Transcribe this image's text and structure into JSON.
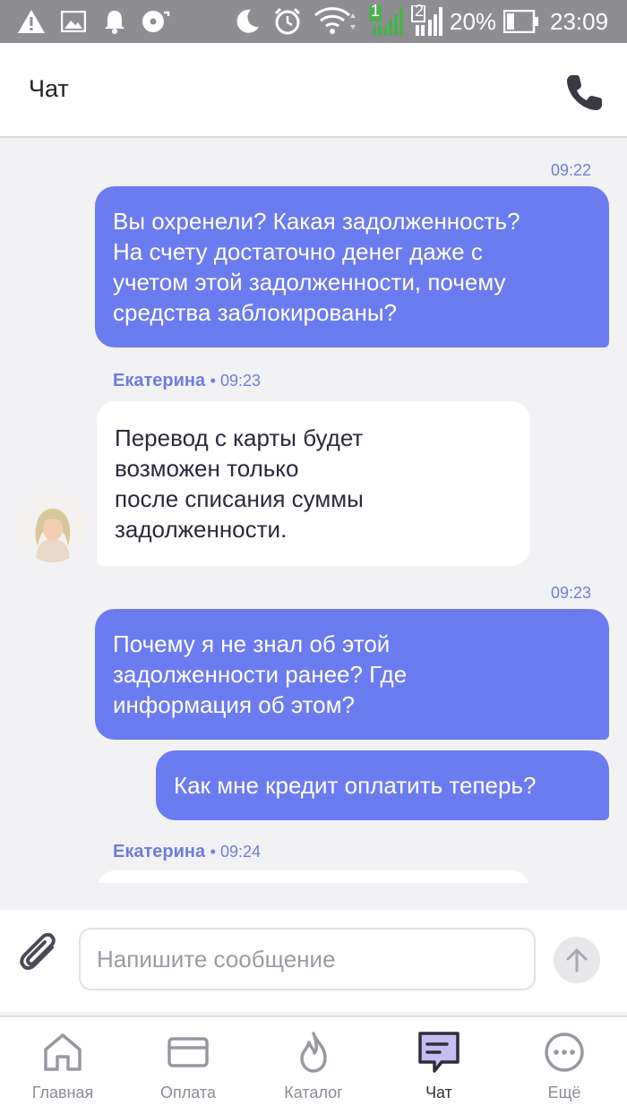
{
  "status_bar": {
    "battery_percent": "20%",
    "time": "23:09",
    "sim1": "1",
    "sim2": "2"
  },
  "header": {
    "title": "Чат"
  },
  "messages": {
    "out1": {
      "time": "09:22",
      "lines": [
        "Вы охренели? Какая задолженность?",
        "На счету достаточно денег даже с",
        "учетом этой задолженности, почему",
        "средства заблокированы?"
      ]
    },
    "in1": {
      "sender": "Екатерина",
      "time": "09:23",
      "lines": [
        "Перевод с карты будет",
        "возможен только",
        "после списания суммы",
        "задолженности."
      ]
    },
    "out2": {
      "time": "09:23",
      "lines": [
        "Почему я не знал об этой",
        "задолженности ранее? Где",
        "информация об этом?"
      ]
    },
    "out3": {
      "lines": [
        "Как мне кредит оплатить теперь?"
      ]
    },
    "in2": {
      "sender": "Екатерина",
      "time": "09:24"
    }
  },
  "composer": {
    "placeholder": "Напишите сообщение"
  },
  "tabs": [
    {
      "label": "Главная",
      "icon": "home-icon"
    },
    {
      "label": "Оплата",
      "icon": "card-icon"
    },
    {
      "label": "Каталог",
      "icon": "flame-icon"
    },
    {
      "label": "Чат",
      "icon": "chat-icon"
    },
    {
      "label": "Ещё",
      "icon": "more-icon"
    }
  ],
  "colors": {
    "accent": "#6b7bf0",
    "status_bar": "#8e8e92",
    "background": "#f2f2f4"
  }
}
